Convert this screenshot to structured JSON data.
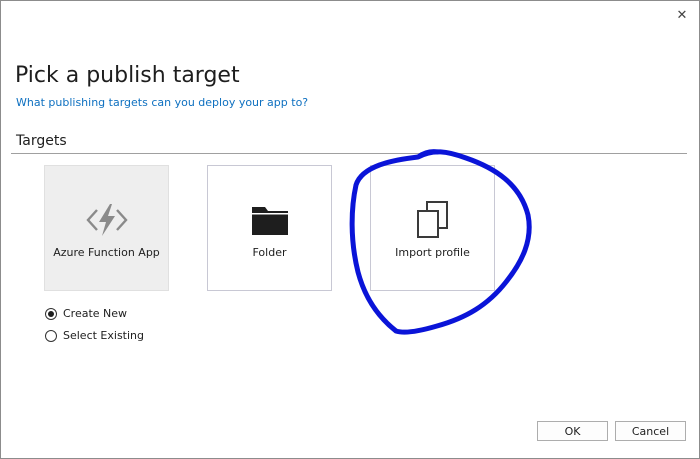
{
  "dialog": {
    "close_glyph": "✕",
    "title": "Pick a publish target",
    "subtitle": "What publishing targets can you deploy your app to?"
  },
  "targets": {
    "section_label": "Targets",
    "tiles": [
      {
        "label": "Azure Function App",
        "icon": "azure-function-icon",
        "selected": true
      },
      {
        "label": "Folder",
        "icon": "folder-icon",
        "selected": false
      },
      {
        "label": "Import profile",
        "icon": "import-profile-icon",
        "selected": false
      }
    ]
  },
  "options": {
    "create_new": "Create New",
    "select_existing": "Select Existing",
    "selected": "create_new"
  },
  "buttons": {
    "ok": "OK",
    "cancel": "Cancel"
  },
  "colors": {
    "accent_link": "#0e70c0",
    "annotation_stroke": "#0a14d8"
  }
}
